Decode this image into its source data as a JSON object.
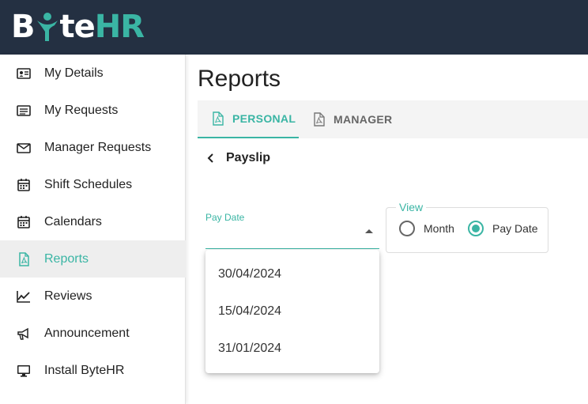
{
  "app": {
    "logo_text": "ByteHR",
    "brand_color": "#3ab5a4",
    "header_color": "#243042"
  },
  "sidebar": {
    "items": [
      {
        "label": "My Details",
        "icon": "id-card-icon"
      },
      {
        "label": "My Requests",
        "icon": "list-icon"
      },
      {
        "label": "Manager Requests",
        "icon": "envelope-icon"
      },
      {
        "label": "Shift Schedules",
        "icon": "calendar-icon"
      },
      {
        "label": "Calendars",
        "icon": "calendar-icon"
      },
      {
        "label": "Reports",
        "icon": "pdf-file-icon",
        "active": true
      },
      {
        "label": "Reviews",
        "icon": "trend-chart-icon"
      },
      {
        "label": "Announcement",
        "icon": "megaphone-icon"
      },
      {
        "label": "Install ByteHR",
        "icon": "monitor-icon"
      }
    ]
  },
  "main": {
    "title": "Reports",
    "tabs": [
      {
        "label": "PERSONAL",
        "icon": "pdf-file-icon",
        "active": true
      },
      {
        "label": "MANAGER",
        "icon": "pdf-file-icon",
        "active": false
      }
    ],
    "back_label": "Payslip",
    "pay_date_select": {
      "label": "Pay Date",
      "value": "",
      "options": [
        "30/04/2024",
        "15/04/2024",
        "31/01/2024"
      ]
    },
    "view": {
      "legend": "View",
      "options": [
        {
          "label": "Month",
          "checked": false
        },
        {
          "label": "Pay Date",
          "checked": true
        }
      ]
    }
  }
}
